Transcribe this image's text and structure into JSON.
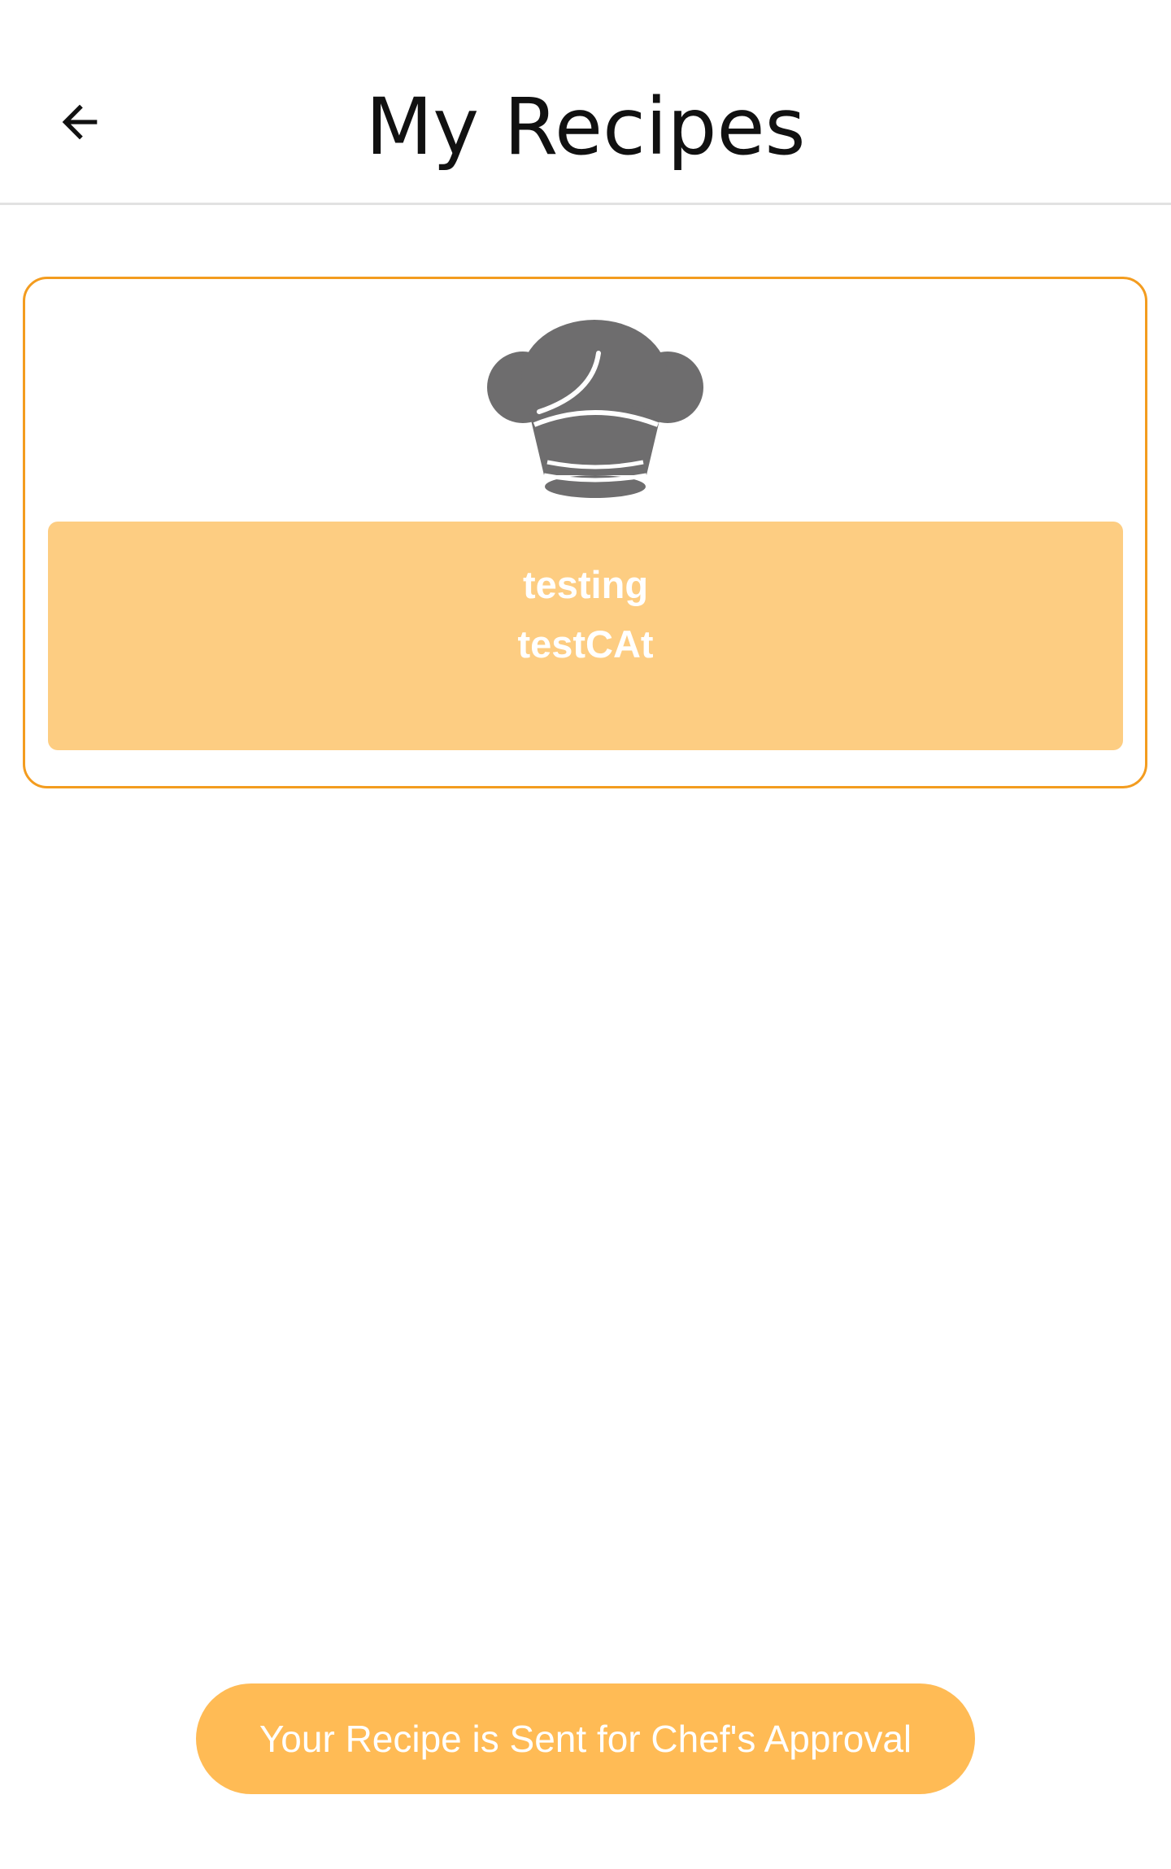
{
  "header": {
    "title": "My Recipes",
    "back_icon": "arrow-left-icon"
  },
  "recipes": [
    {
      "image_icon": "chef-hat-icon",
      "name": "testing",
      "category": "testCAt"
    }
  ],
  "toast": {
    "message": "Your Recipe is Sent for Chef's Approval"
  },
  "colors": {
    "card_border": "#f39c1f",
    "card_info_bg": "#fdcd82",
    "toast_bg": "#ffbb55",
    "icon_gray": "#6e6d6e"
  }
}
